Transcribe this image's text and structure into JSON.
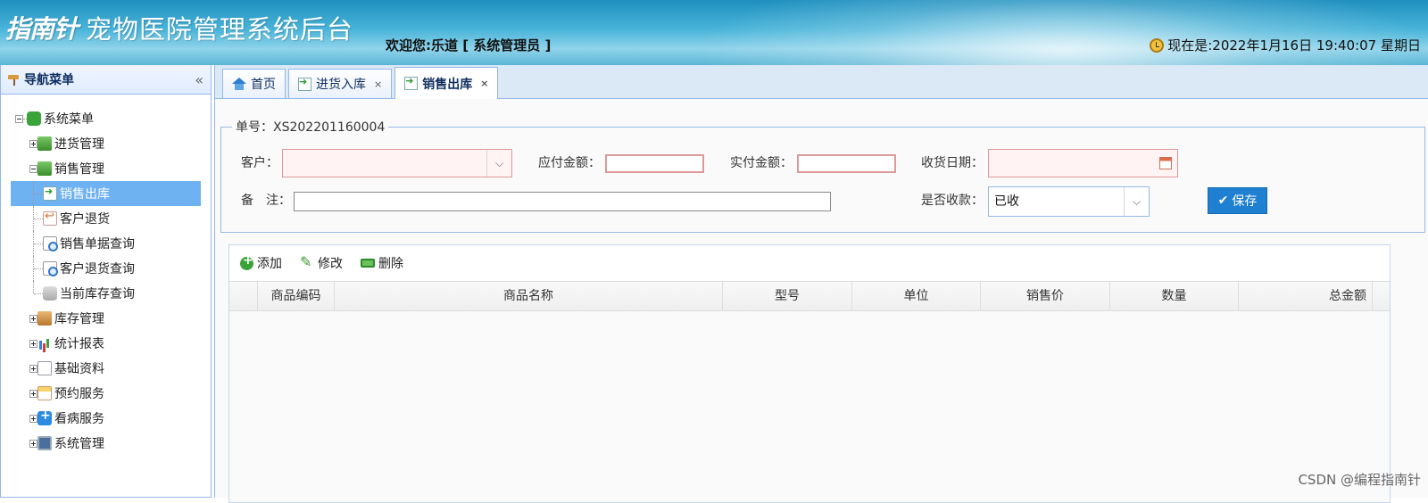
{
  "header": {
    "logo_text": "指南针",
    "app_title": "宠物医院管理系统后台",
    "welcome": "欢迎您:乐道 [ 系统管理员 ]",
    "clock": "现在是:2022年1月16日 19:40:07 星期日"
  },
  "sidebar": {
    "title": "导航菜单",
    "collapse_glyph": "«",
    "root": "系统菜单",
    "items": [
      {
        "label": "进货管理"
      },
      {
        "label": "销售管理"
      },
      {
        "label": "销售出库"
      },
      {
        "label": "客户退货"
      },
      {
        "label": "销售单据查询"
      },
      {
        "label": "客户退货查询"
      },
      {
        "label": "当前库存查询"
      },
      {
        "label": "库存管理"
      },
      {
        "label": "统计报表"
      },
      {
        "label": "基础资料"
      },
      {
        "label": "预约服务"
      },
      {
        "label": "看病服务"
      },
      {
        "label": "系统管理"
      }
    ]
  },
  "tabs": [
    {
      "label": "首页",
      "closable": false
    },
    {
      "label": "进货入库",
      "closable": true
    },
    {
      "label": "销售出库",
      "closable": true,
      "active": true
    }
  ],
  "tab_close_glyph": "×",
  "form": {
    "legend": "单号：XS202201160004",
    "customer_label": "客户：",
    "customer_value": "",
    "payable_label": "应付金额：",
    "payable_value": "",
    "paid_label": "实付金额：",
    "paid_value": "",
    "date_label": "收货日期：",
    "date_value": "",
    "remark_label": "备　注：",
    "remark_value": "",
    "received_label": "是否收款：",
    "received_value": "已收",
    "save_label": "保存"
  },
  "grid": {
    "toolbar": {
      "add": "添加",
      "edit": "修改",
      "delete": "删除"
    },
    "columns": [
      "商品编码",
      "商品名称",
      "型号",
      "单位",
      "销售价",
      "数量",
      "总金额"
    ],
    "rows": []
  },
  "watermark": "CSDN @编程指南针",
  "colors": {
    "accent": "#1f7fd0",
    "selected_row": "#6fb2f2",
    "header_blue": "#49b4d9"
  }
}
